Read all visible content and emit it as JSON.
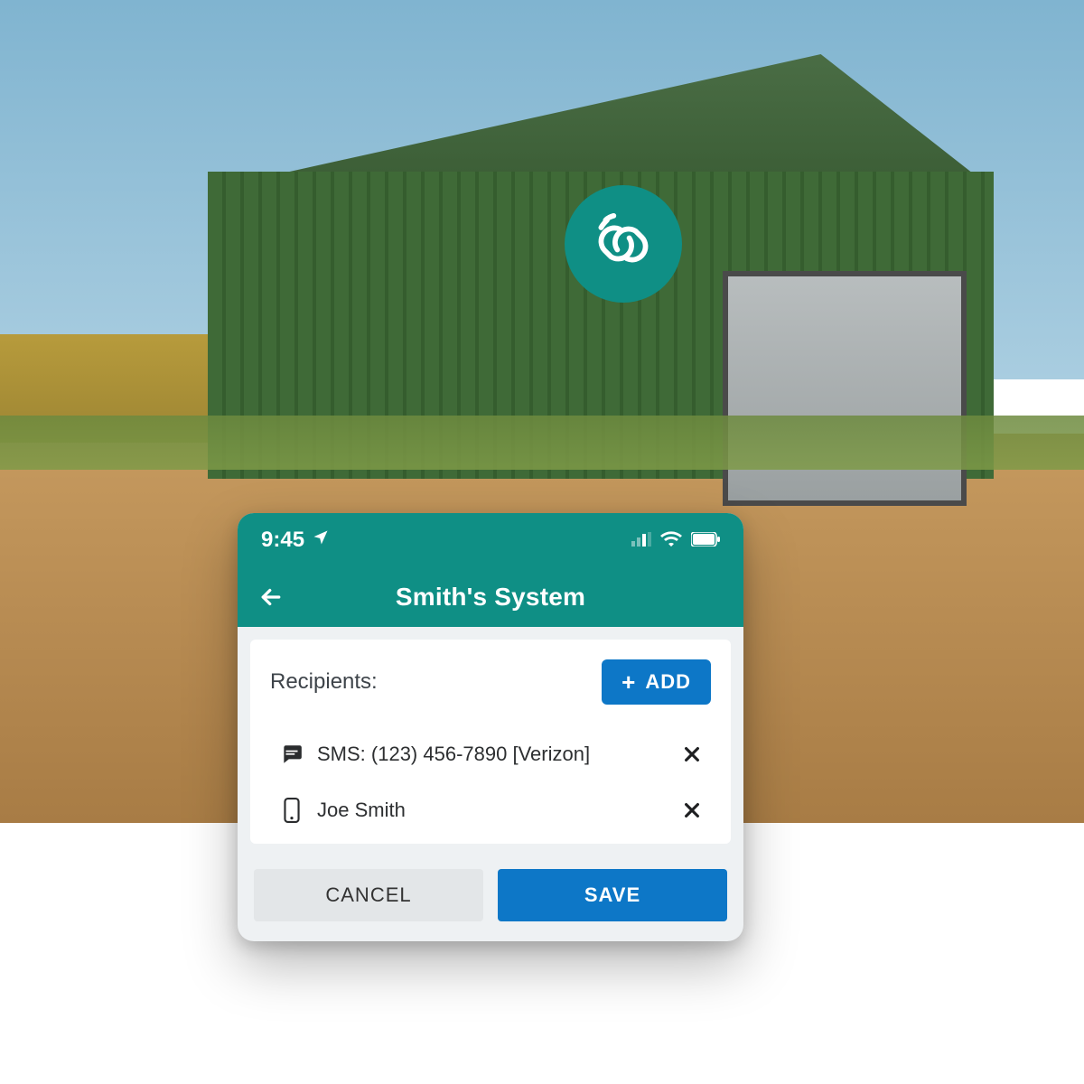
{
  "statusbar": {
    "time": "9:45"
  },
  "header": {
    "title": "Smith's System"
  },
  "panel": {
    "label": "Recipients:",
    "add_label": "ADD"
  },
  "recipients": [
    {
      "text": "SMS: (123) 456-7890 [Verizon]",
      "icon": "sms"
    },
    {
      "text": "Joe Smith",
      "icon": "phone"
    }
  ],
  "footer": {
    "cancel_label": "CANCEL",
    "save_label": "SAVE"
  }
}
